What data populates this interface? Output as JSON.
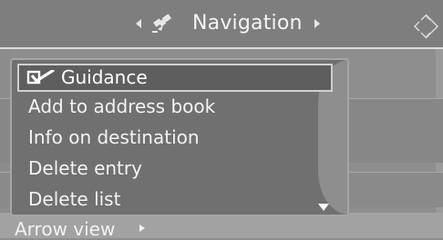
{
  "header": {
    "title": "Navigation",
    "left_arrow": "arrow-left",
    "right_arrow": "arrow-right",
    "satellite_icon": "satellite-icon",
    "controller_icon": "controller-icon"
  },
  "menu": {
    "items": [
      {
        "label": "Guidance",
        "checked": true,
        "selected": true
      },
      {
        "label": "Add to address book",
        "checked": false,
        "selected": false
      },
      {
        "label": "Info on destination",
        "checked": false,
        "selected": false
      },
      {
        "label": "Delete entry",
        "checked": false,
        "selected": false
      },
      {
        "label": "Delete list",
        "checked": false,
        "selected": false
      }
    ],
    "scroll_indicator": "scroll-down-icon"
  },
  "bottom": {
    "label": "Arrow view"
  },
  "colors": {
    "background": "#8e8e8e",
    "header": "#7e7e7e",
    "menu": "#707070",
    "text": "#f3f3f3"
  }
}
